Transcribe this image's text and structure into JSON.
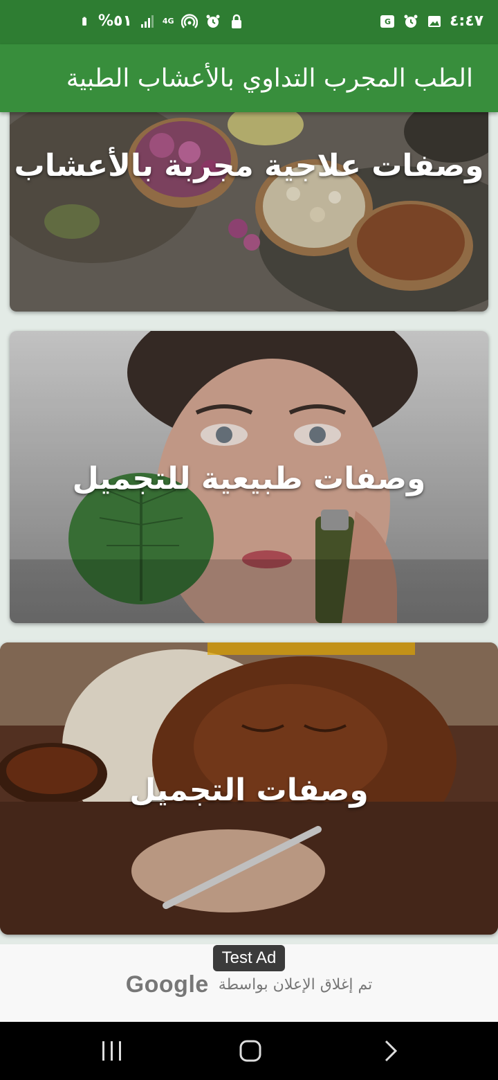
{
  "status_bar": {
    "time": "٤:٤٧",
    "battery_text": "%٥١",
    "network": "4G",
    "icons": [
      "translate-icon",
      "alarm-icon",
      "image-icon",
      "battery-icon",
      "signal-icon",
      "hotspot-icon",
      "alarm-icon",
      "lock-icon"
    ]
  },
  "app_bar": {
    "title": "الطب المجرب التداوي بالأعشاب الطبية",
    "background": "#388e3c"
  },
  "cards": [
    {
      "label": "وصفات علاجية مجربة بالأعشاب",
      "image": "herbs-spoons"
    },
    {
      "label": "وصفات طبيعية للتجميل",
      "image": "woman-face-leaf"
    },
    {
      "label": "وصفات التجميل",
      "image": "chocolate-face-mask"
    }
  ],
  "ad": {
    "badge": "Test Ad",
    "closed_text": "تم إغلاق الإعلان بواسطة",
    "brand": "Google"
  },
  "nav_bar": {
    "buttons": [
      "recent-apps",
      "home",
      "back"
    ]
  }
}
